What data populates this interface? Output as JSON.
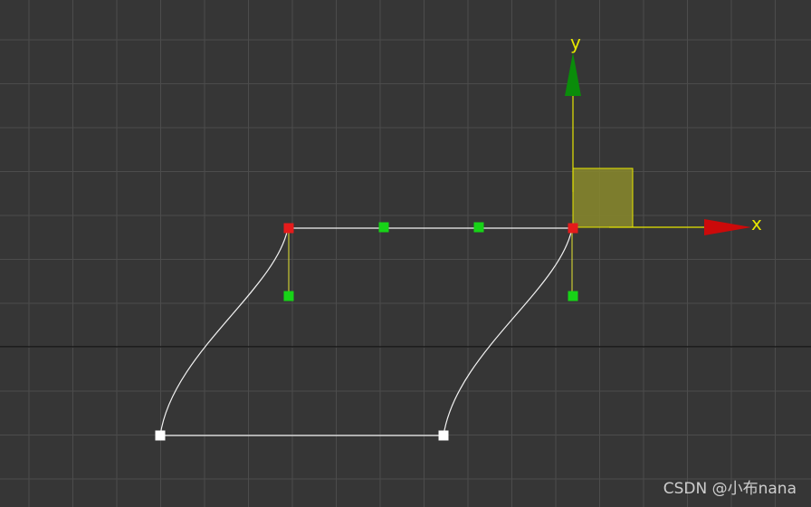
{
  "viewport": {
    "background": "#363636",
    "grid_color": "#4c4c4c",
    "grid_visible": true,
    "horizon_line_color": "#111111"
  },
  "spline": {
    "stroke": "#f2f2f2",
    "vertex_selected_color": "#e51b1b",
    "vertex_unselected_color": "#ffffff",
    "handle_color": "#17d317",
    "handle_line_color": "#e6e633"
  },
  "gizmo": {
    "x_axis_label": "x",
    "y_axis_label": "y",
    "x_color": "#cc0a0a",
    "y_color": "#0a8c0a",
    "axis_line_color": "#e6e600",
    "plane_fill": "#8a8a2b",
    "plane_stroke": "#e6e600",
    "label_color": "#e6e600"
  },
  "watermark": {
    "text": "CSDN @小布nana"
  }
}
